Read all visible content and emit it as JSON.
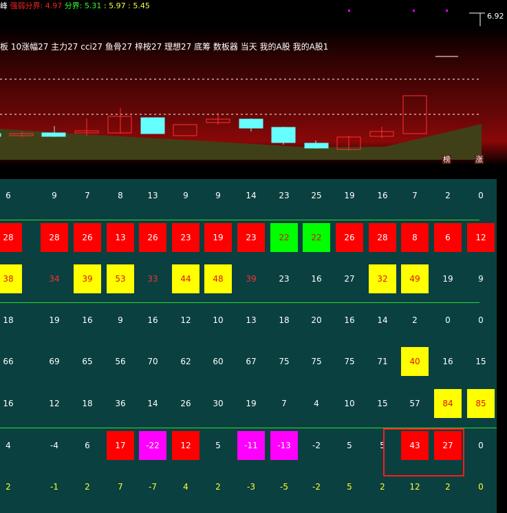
{
  "header": {
    "prefix": "峰",
    "strong_label": "强弱分界:",
    "strong_value": "4.97",
    "divider_label": "分界:",
    "divider_value": "5.31",
    "v2": "5.97",
    "v3": "5.45",
    "sep": ":"
  },
  "price_label": "6.92",
  "menu": "板 10涨幅27 主力27 cci27 鱼骨27 梓桉27 理想27 底筹 数板器 当天 我的A股 我的A股1",
  "tags": [
    "榜",
    "涨"
  ],
  "colors": {
    "red": "#ff0000",
    "yellow": "#ffff00",
    "green": "#00ff00",
    "magenta": "#ff00ff",
    "text_white": "#ffffff",
    "text_red": "#ff3030",
    "text_yellow": "#ffff33",
    "panel": "#0a4040"
  },
  "grid": {
    "rows": [
      {
        "cells": [
          {
            "v": "6"
          },
          {
            "v": "9"
          },
          {
            "v": "7"
          },
          {
            "v": "8"
          },
          {
            "v": "13"
          },
          {
            "v": "9"
          },
          {
            "v": "9"
          },
          {
            "v": "14"
          },
          {
            "v": "23"
          },
          {
            "v": "25"
          },
          {
            "v": "19"
          },
          {
            "v": "16"
          },
          {
            "v": "7"
          },
          {
            "v": "2"
          },
          {
            "v": "0"
          }
        ]
      },
      {
        "cells": [
          {
            "v": "28",
            "bg": "red"
          },
          {
            "v": "28",
            "bg": "red"
          },
          {
            "v": "26",
            "bg": "red"
          },
          {
            "v": "13",
            "bg": "red"
          },
          {
            "v": "26",
            "bg": "red"
          },
          {
            "v": "23",
            "bg": "red"
          },
          {
            "v": "19",
            "bg": "red"
          },
          {
            "v": "23",
            "bg": "red"
          },
          {
            "v": "22",
            "bg": "green"
          },
          {
            "v": "22",
            "bg": "green"
          },
          {
            "v": "26",
            "bg": "red"
          },
          {
            "v": "28",
            "bg": "red"
          },
          {
            "v": "8",
            "bg": "red"
          },
          {
            "v": "6",
            "bg": "red"
          },
          {
            "v": "12",
            "bg": "red"
          }
        ]
      },
      {
        "cells": [
          {
            "v": "38",
            "bg": "yellow"
          },
          {
            "v": "34",
            "fg": "red"
          },
          {
            "v": "39",
            "bg": "yellow"
          },
          {
            "v": "53",
            "bg": "yellow"
          },
          {
            "v": "33",
            "fg": "red"
          },
          {
            "v": "44",
            "bg": "yellow"
          },
          {
            "v": "48",
            "bg": "yellow"
          },
          {
            "v": "39",
            "fg": "red"
          },
          {
            "v": "23"
          },
          {
            "v": "16"
          },
          {
            "v": "27"
          },
          {
            "v": "32",
            "bg": "yellow"
          },
          {
            "v": "49",
            "bg": "yellow"
          },
          {
            "v": "19"
          },
          {
            "v": "9"
          }
        ]
      },
      {
        "cells": [
          {
            "v": "18"
          },
          {
            "v": "19"
          },
          {
            "v": "16"
          },
          {
            "v": "9"
          },
          {
            "v": "16"
          },
          {
            "v": "12"
          },
          {
            "v": "10"
          },
          {
            "v": "13"
          },
          {
            "v": "18"
          },
          {
            "v": "20"
          },
          {
            "v": "16"
          },
          {
            "v": "14"
          },
          {
            "v": "2"
          },
          {
            "v": "0"
          },
          {
            "v": "0"
          }
        ]
      },
      {
        "cells": [
          {
            "v": "66"
          },
          {
            "v": "69"
          },
          {
            "v": "65"
          },
          {
            "v": "56"
          },
          {
            "v": "70"
          },
          {
            "v": "62"
          },
          {
            "v": "60"
          },
          {
            "v": "67"
          },
          {
            "v": "75"
          },
          {
            "v": "75"
          },
          {
            "v": "75"
          },
          {
            "v": "71"
          },
          {
            "v": "40",
            "bg": "yellow"
          },
          {
            "v": "16"
          },
          {
            "v": "15"
          }
        ]
      },
      {
        "cells": [
          {
            "v": "16"
          },
          {
            "v": "12"
          },
          {
            "v": "18"
          },
          {
            "v": "36"
          },
          {
            "v": "14"
          },
          {
            "v": "26"
          },
          {
            "v": "30"
          },
          {
            "v": "19"
          },
          {
            "v": "7"
          },
          {
            "v": "4"
          },
          {
            "v": "10"
          },
          {
            "v": "15"
          },
          {
            "v": "57"
          },
          {
            "v": "84",
            "bg": "yellow"
          },
          {
            "v": "85",
            "bg": "yellow"
          }
        ]
      },
      {
        "cells": [
          {
            "v": "4"
          },
          {
            "v": "-4"
          },
          {
            "v": "6"
          },
          {
            "v": "17",
            "bg": "red"
          },
          {
            "v": "-22",
            "bg": "magenta"
          },
          {
            "v": "12",
            "bg": "red"
          },
          {
            "v": "5"
          },
          {
            "v": "-11",
            "bg": "magenta"
          },
          {
            "v": "-13",
            "bg": "magenta"
          },
          {
            "v": "-2"
          },
          {
            "v": "5"
          },
          {
            "v": "5"
          },
          {
            "v": "43",
            "bg": "red"
          },
          {
            "v": "27",
            "bg": "red"
          },
          {
            "v": "0"
          }
        ]
      },
      {
        "cells": [
          {
            "v": "2",
            "fg": "yellow"
          },
          {
            "v": "-1",
            "fg": "yellow"
          },
          {
            "v": "2",
            "fg": "yellow"
          },
          {
            "v": "7",
            "fg": "yellow"
          },
          {
            "v": "-7",
            "fg": "yellow"
          },
          {
            "v": "4",
            "fg": "yellow"
          },
          {
            "v": "2",
            "fg": "yellow"
          },
          {
            "v": "-3",
            "fg": "yellow"
          },
          {
            "v": "-5",
            "fg": "yellow"
          },
          {
            "v": "-2",
            "fg": "yellow"
          },
          {
            "v": "5",
            "fg": "yellow"
          },
          {
            "v": "2",
            "fg": "yellow"
          },
          {
            "v": "12",
            "fg": "yellow"
          },
          {
            "v": "2",
            "fg": "yellow"
          },
          {
            "v": "0",
            "fg": "yellow"
          }
        ]
      }
    ]
  }
}
